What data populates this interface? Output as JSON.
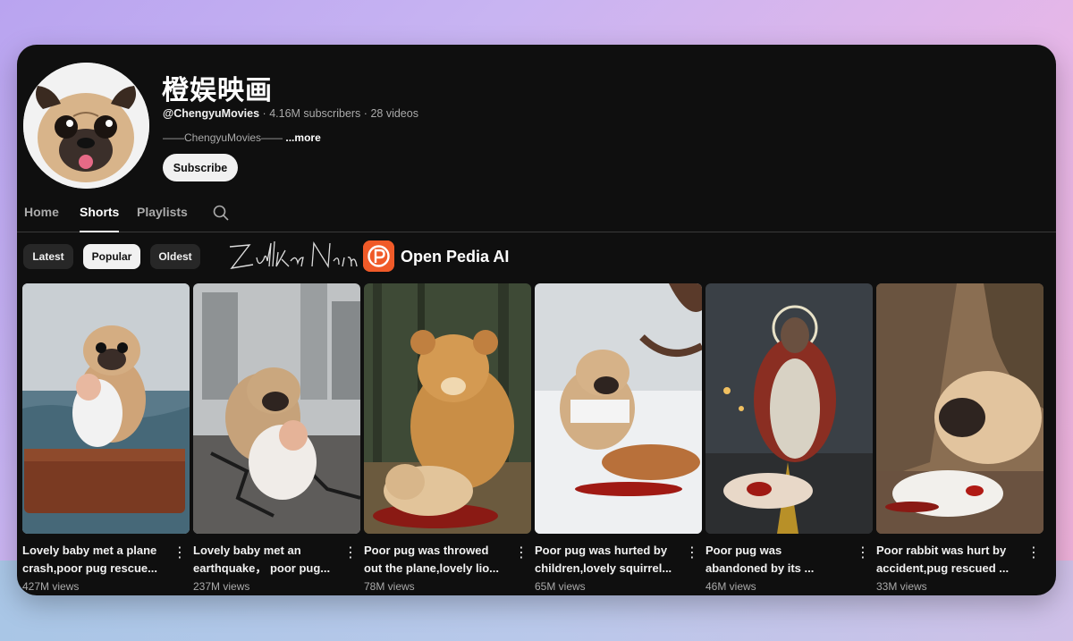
{
  "channel": {
    "name": "橙娱映画",
    "handle": "@ChengyuMovies",
    "subscribers": "4.16M subscribers",
    "videos": "28 videos",
    "separator": "·",
    "description": "——ChengyuMovies——",
    "more_label": "...more",
    "subscribe_label": "Subscribe"
  },
  "tabs": [
    {
      "label": "Home",
      "active": false
    },
    {
      "label": "Shorts",
      "active": true
    },
    {
      "label": "Playlists",
      "active": false
    }
  ],
  "filters": [
    {
      "label": "Latest",
      "active": false
    },
    {
      "label": "Popular",
      "active": true
    },
    {
      "label": "Oldest",
      "active": false
    }
  ],
  "watermark": {
    "signature": "Zulkar Naim",
    "brand": "Open Pedia AI",
    "brand_color": "#f05a28"
  },
  "shorts": [
    {
      "line1": "Lovely baby met a plane",
      "line2": "crash,poor pug rescue...",
      "views": "427M views"
    },
    {
      "line1": "Lovely baby met an",
      "line2": "earthquake， poor pug...",
      "views": "237M views"
    },
    {
      "line1": "Poor pug was throwed",
      "line2": "out the plane,lovely lio...",
      "views": "78M views"
    },
    {
      "line1": "Poor pug was hurted by",
      "line2": "children,lovely squirrel...",
      "views": "65M views"
    },
    {
      "line1": "Poor pug was",
      "line2": "abandoned by its ...",
      "views": "46M views"
    },
    {
      "line1": "Poor rabbit was hurt by",
      "line2": "accident,pug rescued ...",
      "views": "33M views"
    }
  ],
  "icons": {
    "search": "search-icon",
    "kebab": "more-vert-icon"
  }
}
